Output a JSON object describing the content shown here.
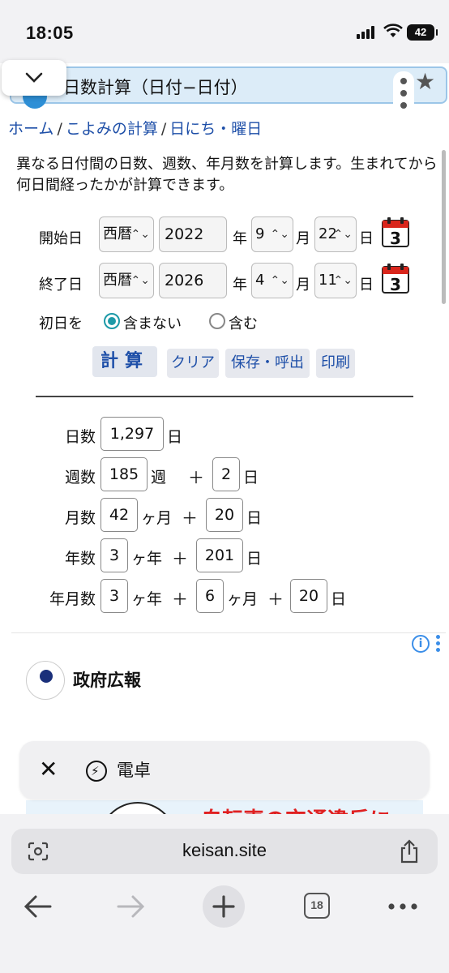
{
  "status": {
    "time": "18:05",
    "battery": "42"
  },
  "page": {
    "title": "日数計算（日付−日付）",
    "breadcrumb": [
      "ホーム",
      "こよみの計算",
      "日にち・曜日"
    ],
    "breadcrumb_sep": "/",
    "intro": "異なる日付間の日数、週数、年月数を計算します。生まれてから何日間経ったかが計算できます。"
  },
  "form": {
    "start": {
      "label": "開始日",
      "era": "西暦",
      "year": "2022",
      "month": "9",
      "day": "22"
    },
    "end": {
      "label": "終了日",
      "era": "西暦",
      "year": "2026",
      "month": "4",
      "day": "11"
    },
    "unit_year": "年",
    "unit_month": "月",
    "unit_day": "日",
    "select_arrow": "⌃⌄",
    "calendar_icon_number": "3",
    "first_day_label": "初日を",
    "option_exclude": "含まない",
    "option_include": "含む",
    "first_day_selected": "含まない",
    "buttons": {
      "calc": "計算",
      "clear": "クリア",
      "save": "保存・呼出",
      "print": "印刷"
    }
  },
  "results": {
    "days": {
      "label": "日数",
      "value": "1,297",
      "unit": "日"
    },
    "weeks": {
      "label": "週数",
      "value": "185",
      "unit": "週",
      "plus": "＋",
      "rem": "2",
      "rem_unit": "日"
    },
    "months": {
      "label": "月数",
      "value": "42",
      "unit": "ヶ月",
      "plus": "＋",
      "rem": "20",
      "rem_unit": "日"
    },
    "years": {
      "label": "年数",
      "value": "3",
      "unit": "ヶ年",
      "plus": "＋",
      "rem": "201",
      "rem_unit": "日"
    },
    "ymd": {
      "label": "年月数",
      "y": "3",
      "y_unit": "ヶ年",
      "plus": "＋",
      "m": "6",
      "m_unit": "ヶ月",
      "d": "20",
      "d_unit": "日"
    }
  },
  "ad": {
    "brand": "政府広報",
    "headline": "自転車の交通違反に",
    "info": "i"
  },
  "tooltip": {
    "close": "✕",
    "label": "電卓"
  },
  "browser": {
    "url": "keisan.site",
    "tab_count": "18"
  },
  "colors": {
    "accent": "#1e4fa8",
    "radio": "#1d9aa8",
    "calendar_red": "#d9261c"
  }
}
